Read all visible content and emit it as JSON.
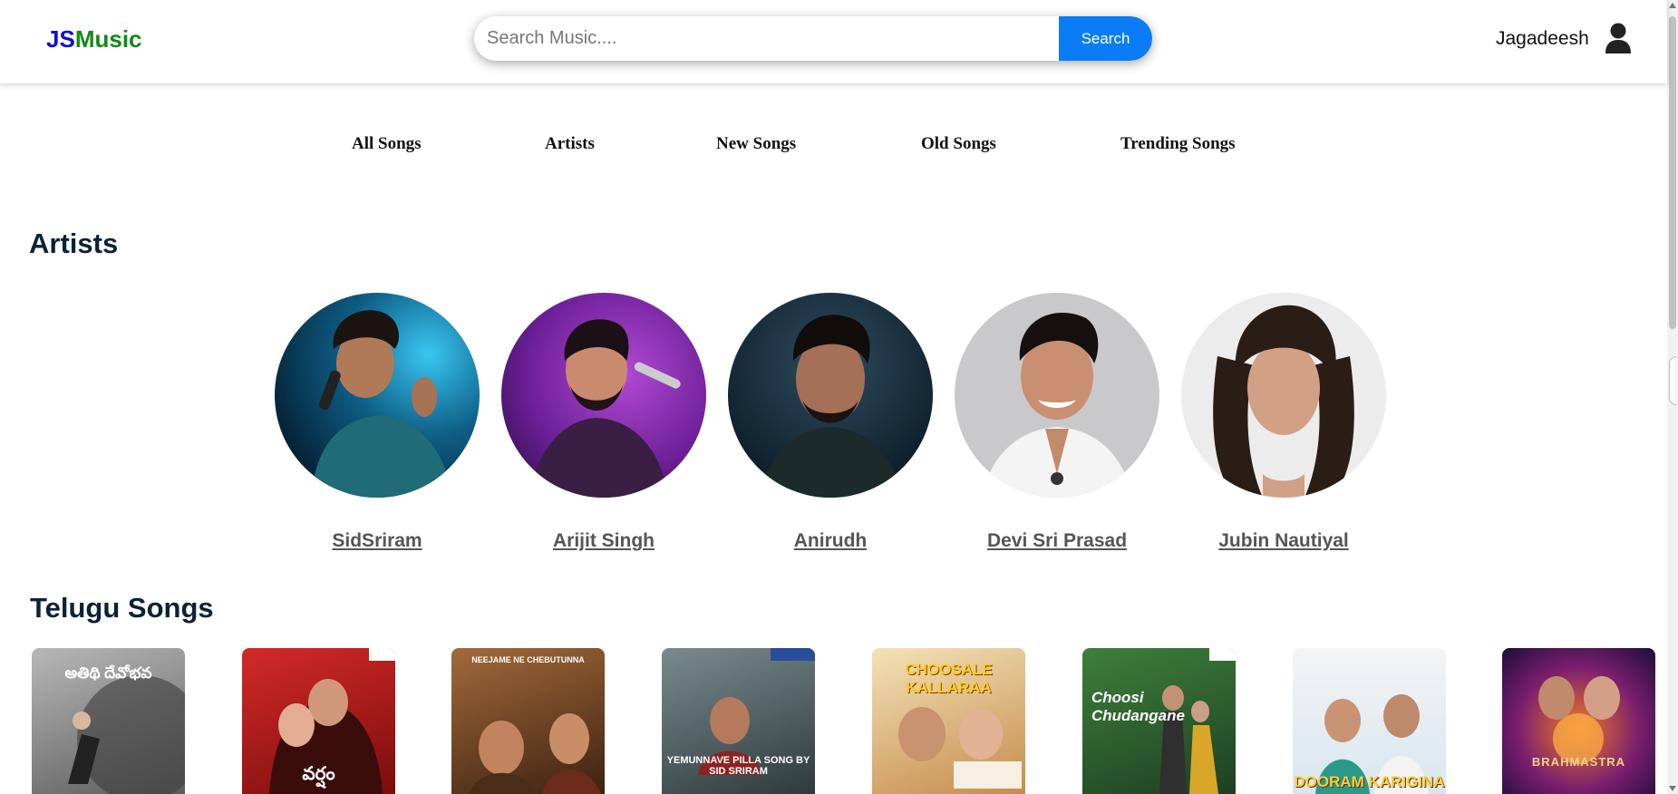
{
  "header": {
    "logo_part1": "JS",
    "logo_part2": "Music",
    "search_placeholder": "Search Music....",
    "search_value": "",
    "search_button": "Search",
    "user_name": "Jagadeesh",
    "user_icon": "user-icon"
  },
  "nav": {
    "items": [
      {
        "label": "All Songs"
      },
      {
        "label": "Artists"
      },
      {
        "label": "New Songs"
      },
      {
        "label": "Old Songs"
      },
      {
        "label": "Trending Songs"
      }
    ]
  },
  "artists_section": {
    "title": "Artists",
    "items": [
      {
        "name": "SidSriram"
      },
      {
        "name": "Arijit Singh"
      },
      {
        "name": "Anirudh"
      },
      {
        "name": "Devi Sri Prasad"
      },
      {
        "name": "Jubin Nautiyal"
      }
    ]
  },
  "telugu_section": {
    "title": "Telugu Songs",
    "songs": [
      {
        "caption": "అతిథి దేవోభవ"
      },
      {
        "caption": "వర్షం"
      },
      {
        "caption": "NEEJAME NE CHEBUTUNNA"
      },
      {
        "caption": "YEMUNNAVE PILLA SONG BY SID SRIRAM"
      },
      {
        "caption": "CHOOSALE KALLARAA"
      },
      {
        "caption": "Choosi Chudangane"
      },
      {
        "caption": "DOORAM KARIGINA"
      },
      {
        "caption": "BRAHMASTRA"
      }
    ]
  },
  "colors": {
    "logo_js": "#1010d0",
    "logo_music": "#138a13",
    "search_button_bg": "#0a7cf6",
    "section_title": "#0c2236",
    "artist_link": "#555555"
  }
}
